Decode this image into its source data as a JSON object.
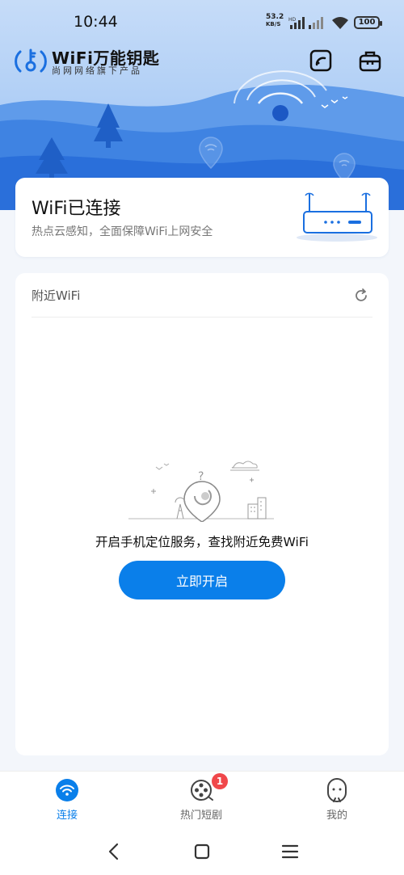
{
  "status_bar": {
    "time": "10:44",
    "speed_value": "53.2",
    "speed_unit": "KB/S",
    "battery": "100"
  },
  "header": {
    "brand_title": "WiFi万能钥匙",
    "brand_subtitle": "尚网网络旗下产品",
    "icons": [
      "tablet-icon",
      "toolbox-icon"
    ]
  },
  "connected": {
    "title": "WiFi已连接",
    "subtitle": "热点云感知，全面保障WiFi上网安全",
    "icon": "router-icon"
  },
  "nearby": {
    "title": "附近WiFi",
    "message": "开启手机定位服务，查找附近免费WiFi",
    "button_label": "立即开启"
  },
  "tabs": [
    {
      "label": "连接",
      "icon": "wifi-icon",
      "active": true
    },
    {
      "label": "热门短剧",
      "icon": "film-reel-icon",
      "badge": "1"
    },
    {
      "label": "我的",
      "icon": "face-icon"
    }
  ],
  "colors": {
    "accent": "#0a7fea",
    "badge": "#f0474a",
    "header_blue": "#8fbaf0"
  }
}
